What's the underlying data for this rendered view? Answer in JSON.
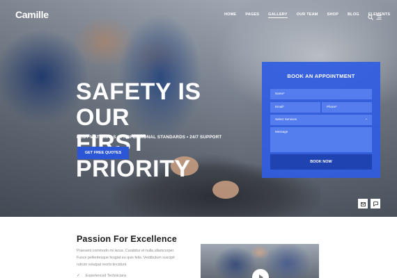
{
  "brand": {
    "logo": "Camille"
  },
  "nav": {
    "items": [
      {
        "label": "HOME"
      },
      {
        "label": "PAGES"
      },
      {
        "label": "GALLERY"
      },
      {
        "label": "OUR TEAM"
      },
      {
        "label": "SHOP"
      },
      {
        "label": "BLOG"
      },
      {
        "label": "ELEMENTS"
      }
    ],
    "icons": [
      "search-icon",
      "menu-icon"
    ]
  },
  "hero": {
    "headline_line1": "SAFETY IS OUR",
    "headline_line2": "FIRST PRIORITY",
    "tagline": "BEST MATERIALS  •  PROFESSIONAL STANDARDS  •  24/7 SUPPORT",
    "cta_label": "GET FREE QUOTES"
  },
  "appointment": {
    "title": "BOOK AN APPOINTMENT",
    "name_placeholder": "Name*",
    "email_placeholder": "Email*",
    "phone_placeholder": "Phone*",
    "service_placeholder": "Select Services",
    "message_placeholder": "Message",
    "submit_label": "BOOK NOW"
  },
  "floating": {
    "icons": [
      "mail-icon",
      "chat-icon"
    ]
  },
  "about": {
    "title": "Passion For Excellence",
    "text": "Praesent commodo mi lacus. Curabitur et nulla ullamcorper. Fusce pellentesque feugiat eu quis felis. Vestibulum suscipit rutrum volutpat morbi tincidunt",
    "feature": "Experienced Technicians"
  },
  "colors": {
    "accent": "#2b56d6",
    "form_bg": "#305ce1",
    "button_dark": "#1f43b0"
  }
}
